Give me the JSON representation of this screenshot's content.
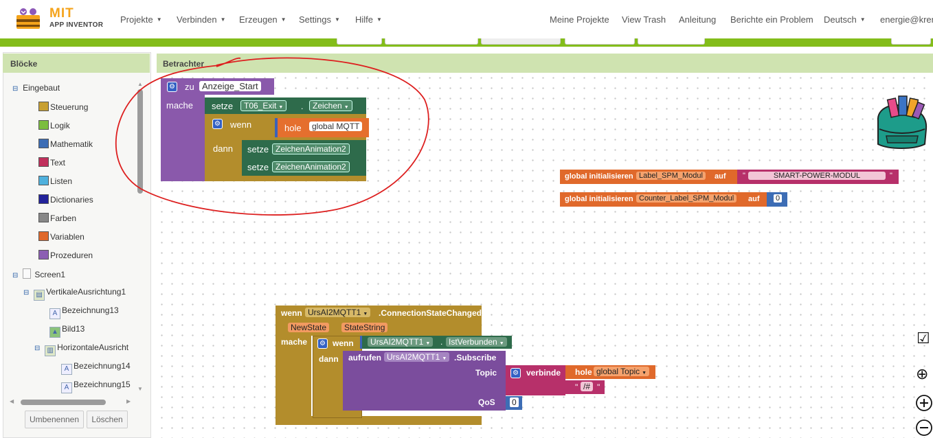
{
  "app": {
    "logo_mit": "MIT",
    "logo_sub": "APP INVENTOR"
  },
  "menus": {
    "projekte": "Projekte",
    "verbinden": "Verbinden",
    "erzeugen": "Erzeugen",
    "settings": "Settings",
    "hilfe": "Hilfe",
    "meine_projekte": "Meine Projekte",
    "view_trash": "View Trash",
    "anleitung": "Anleitung",
    "berichte": "Berichte ein Problem",
    "deutsch": "Deutsch",
    "user": "energie@krent"
  },
  "left_panel": {
    "title": "Blöcke",
    "eingebaut": "Eingebaut",
    "builtin": [
      {
        "label": "Steuerung",
        "color": "#c8a032"
      },
      {
        "label": "Logik",
        "color": "#7bbd3f"
      },
      {
        "label": "Mathematik",
        "color": "#3d6db5"
      },
      {
        "label": "Text",
        "color": "#c0305c"
      },
      {
        "label": "Listen",
        "color": "#4fb1dd"
      },
      {
        "label": "Dictionaries",
        "color": "#22229a"
      },
      {
        "label": "Farben",
        "color": "#888888"
      },
      {
        "label": "Variablen",
        "color": "#e0692b"
      },
      {
        "label": "Prozeduren",
        "color": "#8c5fb3"
      }
    ],
    "screen1": "Screen1",
    "vertikale": "VertikaleAusrichtung1",
    "bez13": "Bezeichnung13",
    "bild13": "Bild13",
    "horizontale": "HorizontaleAusricht",
    "bez14": "Bezeichnung14",
    "bez15": "Bezeichnung15",
    "rename_btn": "Umbenennen",
    "delete_btn": "Löschen"
  },
  "viewer": {
    "title": "Betrachter"
  },
  "blocks": {
    "proc": {
      "zu": "zu",
      "name": "Anzeige_Start",
      "mache": "mache"
    },
    "setze1": {
      "setze": "setze",
      "comp": "T06_Exit",
      "dot": ".",
      "prop": "Zeichen"
    },
    "wenn1": {
      "wenn": "wenn",
      "hole": "hole",
      "var": "global MQTT"
    },
    "dann1": "dann",
    "setze2": {
      "setze": "setze",
      "comp": "ZeichenAnimation2"
    },
    "setze3": {
      "setze": "setze",
      "comp": "ZeichenAnimation2"
    },
    "init1": {
      "label": "global initialisieren",
      "name": "Label_SPM_Modul",
      "auf": "auf",
      "text": "SMART-POWER-MODUL"
    },
    "init2": {
      "label": "global initialisieren",
      "name": "Counter_Label_SPM_Modul",
      "auf": "auf",
      "value": "0"
    },
    "event": {
      "wenn": "wenn",
      "comp": "UrsAI2MQTT1",
      "event": ".ConnectionStateChanged",
      "param1": "NewState",
      "param2": "StateString",
      "mache": "mache",
      "wenn2": "wenn",
      "comp2": "UrsAI2MQTT1",
      "dot": ".",
      "prop": "IstVerbunden",
      "dann": "dann",
      "aufrufen": "aufrufen",
      "comp3": "UrsAI2MQTT1",
      "method": ".Subscribe",
      "topic": "Topic",
      "verbinde": "verbinde",
      "hole": "hole",
      "topic_var": "global Topic",
      "hash": "/#",
      "qos": "QoS",
      "qos_value": "0"
    }
  }
}
